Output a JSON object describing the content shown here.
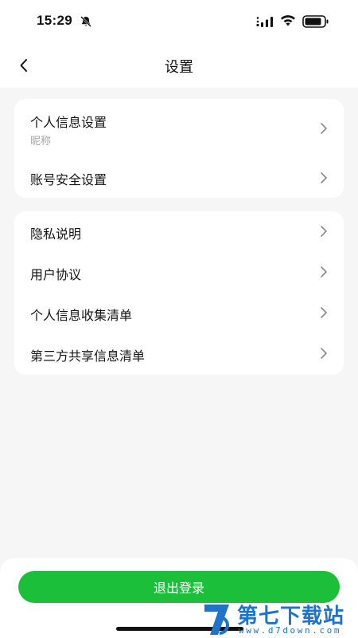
{
  "status_bar": {
    "time": "15:29",
    "icons": [
      "bell-off-icon",
      "signal-icon",
      "wifi-icon",
      "battery-icon"
    ]
  },
  "nav": {
    "title": "设置",
    "back_icon": "chevron-left-icon"
  },
  "account_section": {
    "items": [
      {
        "label": "个人信息设置",
        "sublabel": "昵称"
      },
      {
        "label": "账号安全设置"
      }
    ]
  },
  "info_section": {
    "items": [
      {
        "label": "隐私说明"
      },
      {
        "label": "用户协议"
      },
      {
        "label": "个人信息收集清单"
      },
      {
        "label": "第三方共享信息清单"
      }
    ]
  },
  "logout": {
    "label": "退出登录"
  },
  "watermark": {
    "name": "第七下载站",
    "url": "www.d7down.com"
  },
  "colors": {
    "accent": "#1cbf3a",
    "background": "#f6f6f6",
    "card": "#ffffff",
    "watermark": "#1f74c8"
  }
}
